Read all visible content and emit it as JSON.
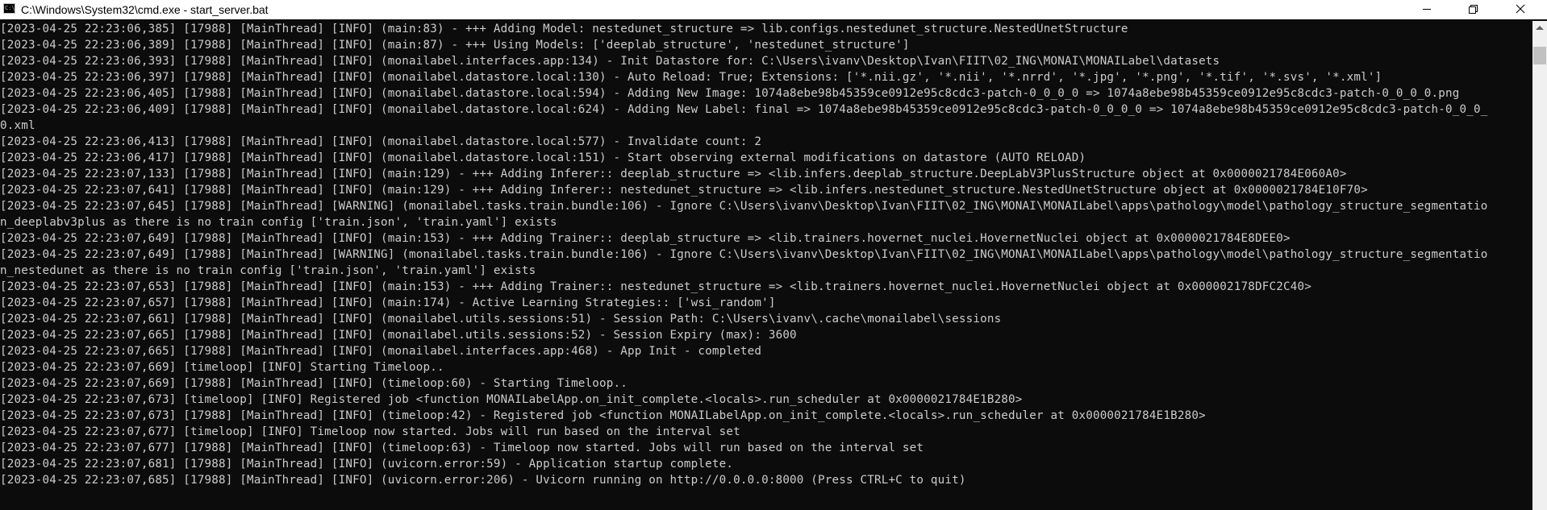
{
  "window": {
    "title": "C:\\Windows\\System32\\cmd.exe - start_server.bat",
    "icon": "cmd-icon",
    "icon_text": "C:\\",
    "controls": [
      "minimize-icon",
      "restore-icon",
      "close-icon"
    ]
  },
  "console": {
    "lines": [
      "[2023-04-25 22:23:06,385] [17988] [MainThread] [INFO] (main:83) - +++ Adding Model: nestedunet_structure => lib.configs.nestedunet_structure.NestedUnetStructure",
      "[2023-04-25 22:23:06,389] [17988] [MainThread] [INFO] (main:87) - +++ Using Models: ['deeplab_structure', 'nestedunet_structure']",
      "[2023-04-25 22:23:06,393] [17988] [MainThread] [INFO] (monailabel.interfaces.app:134) - Init Datastore for: C:\\Users\\ivanv\\Desktop\\Ivan\\FIIT\\02_ING\\MONAI\\MONAILabel\\datasets",
      "[2023-04-25 22:23:06,397] [17988] [MainThread] [INFO] (monailabel.datastore.local:130) - Auto Reload: True; Extensions: ['*.nii.gz', '*.nii', '*.nrrd', '*.jpg', '*.png', '*.tif', '*.svs', '*.xml']",
      "[2023-04-25 22:23:06,405] [17988] [MainThread] [INFO] (monailabel.datastore.local:594) - Adding New Image: 1074a8ebe98b45359ce0912e95c8cdc3-patch-0_0_0_0 => 1074a8ebe98b45359ce0912e95c8cdc3-patch-0_0_0_0.png",
      "[2023-04-25 22:23:06,409] [17988] [MainThread] [INFO] (monailabel.datastore.local:624) - Adding New Label: final => 1074a8ebe98b45359ce0912e95c8cdc3-patch-0_0_0_0 => 1074a8ebe98b45359ce0912e95c8cdc3-patch-0_0_0_",
      "0.xml",
      "[2023-04-25 22:23:06,413] [17988] [MainThread] [INFO] (monailabel.datastore.local:577) - Invalidate count: 2",
      "[2023-04-25 22:23:06,417] [17988] [MainThread] [INFO] (monailabel.datastore.local:151) - Start observing external modifications on datastore (AUTO RELOAD)",
      "[2023-04-25 22:23:07,133] [17988] [MainThread] [INFO] (main:129) - +++ Adding Inferer:: deeplab_structure => <lib.infers.deeplab_structure.DeepLabV3PlusStructure object at 0x0000021784E060A0>",
      "[2023-04-25 22:23:07,641] [17988] [MainThread] [INFO] (main:129) - +++ Adding Inferer:: nestedunet_structure => <lib.infers.nestedunet_structure.NestedUnetStructure object at 0x0000021784E10F70>",
      "[2023-04-25 22:23:07,645] [17988] [MainThread] [WARNING] (monailabel.tasks.train.bundle:106) - Ignore C:\\Users\\ivanv\\Desktop\\Ivan\\FIIT\\02_ING\\MONAI\\MONAILabel\\apps\\pathology\\model\\pathology_structure_segmentatio",
      "n_deeplabv3plus as there is no train config ['train.json', 'train.yaml'] exists",
      "[2023-04-25 22:23:07,649] [17988] [MainThread] [INFO] (main:153) - +++ Adding Trainer:: deeplab_structure => <lib.trainers.hovernet_nuclei.HovernetNuclei object at 0x0000021784E8DEE0>",
      "[2023-04-25 22:23:07,649] [17988] [MainThread] [WARNING] (monailabel.tasks.train.bundle:106) - Ignore C:\\Users\\ivanv\\Desktop\\Ivan\\FIIT\\02_ING\\MONAI\\MONAILabel\\apps\\pathology\\model\\pathology_structure_segmentatio",
      "n_nestedunet as there is no train config ['train.json', 'train.yaml'] exists",
      "[2023-04-25 22:23:07,653] [17988] [MainThread] [INFO] (main:153) - +++ Adding Trainer:: nestedunet_structure => <lib.trainers.hovernet_nuclei.HovernetNuclei object at 0x000002178DFC2C40>",
      "[2023-04-25 22:23:07,657] [17988] [MainThread] [INFO] (main:174) - Active Learning Strategies:: ['wsi_random']",
      "[2023-04-25 22:23:07,661] [17988] [MainThread] [INFO] (monailabel.utils.sessions:51) - Session Path: C:\\Users\\ivanv\\.cache\\monailabel\\sessions",
      "[2023-04-25 22:23:07,665] [17988] [MainThread] [INFO] (monailabel.utils.sessions:52) - Session Expiry (max): 3600",
      "[2023-04-25 22:23:07,665] [17988] [MainThread] [INFO] (monailabel.interfaces.app:468) - App Init - completed",
      "[2023-04-25 22:23:07,669] [timeloop] [INFO] Starting Timeloop..",
      "[2023-04-25 22:23:07,669] [17988] [MainThread] [INFO] (timeloop:60) - Starting Timeloop..",
      "[2023-04-25 22:23:07,673] [timeloop] [INFO] Registered job <function MONAILabelApp.on_init_complete.<locals>.run_scheduler at 0x0000021784E1B280>",
      "[2023-04-25 22:23:07,673] [17988] [MainThread] [INFO] (timeloop:42) - Registered job <function MONAILabelApp.on_init_complete.<locals>.run_scheduler at 0x0000021784E1B280>",
      "[2023-04-25 22:23:07,677] [timeloop] [INFO] Timeloop now started. Jobs will run based on the interval set",
      "[2023-04-25 22:23:07,677] [17988] [MainThread] [INFO] (timeloop:63) - Timeloop now started. Jobs will run based on the interval set",
      "[2023-04-25 22:23:07,681] [17988] [MainThread] [INFO] (uvicorn.error:59) - Application startup complete.",
      "[2023-04-25 22:23:07,685] [17988] [MainThread] [INFO] (uvicorn.error:206) - Uvicorn running on http://0.0.0.0:8000 (Press CTRL+C to quit)"
    ]
  }
}
